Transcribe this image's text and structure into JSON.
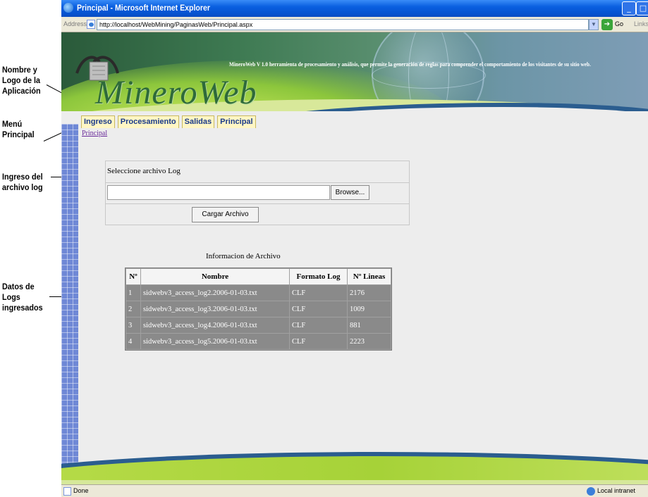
{
  "annotations": {
    "app_name_logo": [
      "Nombre y",
      "Logo de la",
      "Aplicación"
    ],
    "main_menu": [
      "Menú",
      "Principal"
    ],
    "log_input": [
      "Ingreso del",
      "archivo log"
    ],
    "log_data": [
      "Datos de",
      "Logs",
      "ingresados"
    ]
  },
  "window": {
    "title": "Principal - Microsoft Internet Explorer",
    "address_label": "Address",
    "url": "http://localhost/WebMining/PaginasWeb/Principal.aspx",
    "go_label": "Go",
    "links_label": "Links"
  },
  "banner": {
    "tagline": "MineroWeb V 1.0 herramienta de procesamiento y análisis, que permite la generación de reglas para comprender el comportamiento de los visitantes de su sitio web.",
    "logo_text": "MineroWeb",
    "logo_icon": "pickaxe-icon"
  },
  "menu": {
    "items": [
      {
        "label": "Ingreso"
      },
      {
        "label": "Procesamiento"
      },
      {
        "label": "Salidas"
      },
      {
        "label": "Principal"
      }
    ]
  },
  "breadcrumb": "Principal",
  "upload": {
    "prompt": "Seleccione archivo Log",
    "file_value": "",
    "browse_label": "Browse...",
    "load_label": "Cargar Archivo"
  },
  "table": {
    "caption": "Informacion de Archivo",
    "headers": [
      "Nº",
      "Nombre",
      "Formato Log",
      "Nº Lineas"
    ],
    "rows": [
      [
        "1",
        "sidwebv3_access_log2.2006-01-03.txt",
        "CLF",
        "2176"
      ],
      [
        "2",
        "sidwebv3_access_log3.2006-01-03.txt",
        "CLF",
        "1009"
      ],
      [
        "3",
        "sidwebv3_access_log4.2006-01-03.txt",
        "CLF",
        "881"
      ],
      [
        "4",
        "sidwebv3_access_log5.2006-01-03.txt",
        "CLF",
        "2223"
      ]
    ]
  },
  "status": {
    "text": "Done",
    "zone": "Local intranet"
  },
  "colors": {
    "title_bar": "#0553d0",
    "menu_tab_bg": "#fff6c4",
    "menu_tab_text": "#1a3a8a",
    "table_cell_bg": "#8a8a8a",
    "logo_green": "#2e6a3a"
  }
}
